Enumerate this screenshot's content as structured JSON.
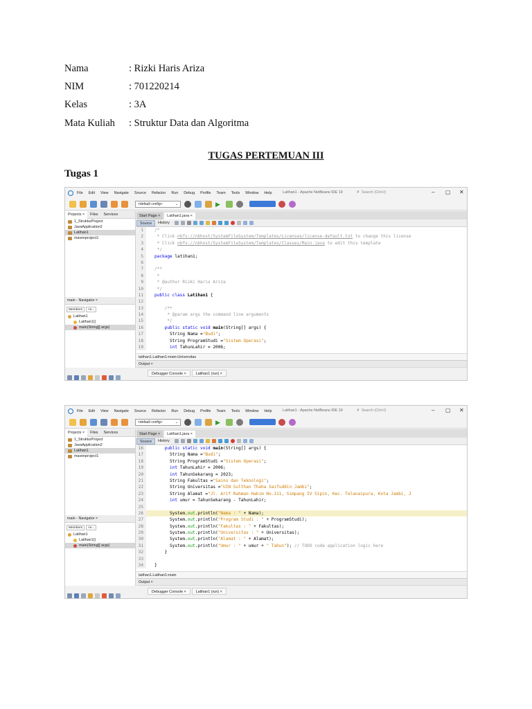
{
  "student": {
    "rows": [
      {
        "label": "Nama",
        "value": ": Rizki Haris Ariza"
      },
      {
        "label": "NIM",
        "value": ": 701220214"
      },
      {
        "label": "Kelas",
        "value": ": 3A"
      },
      {
        "label": "Mata Kuliah",
        "value": ": Struktur Data dan Algoritma"
      }
    ]
  },
  "heading": "TUGAS PERTEMUAN III",
  "task": "Tugas 1",
  "ide": {
    "menu": [
      "File",
      "Edit",
      "View",
      "Navigate",
      "Source",
      "Refactor",
      "Run",
      "Debug",
      "Profile",
      "Team",
      "Tools",
      "Window",
      "Help"
    ],
    "window_title": "Latihan1 - Apache NetBeans IDE 19",
    "search_placeholder": "Search (Ctrl+I)",
    "config": "<default config>",
    "panel_tabs": [
      "Projects ×",
      "Files",
      "Services"
    ],
    "projects": [
      "1_StrukturProject",
      "JavaApplication2",
      "Latihan1",
      "mavenproject1"
    ],
    "navigator_title": "main - Navigator ×",
    "members_label": "Members",
    "members_filter": "<e...",
    "navigator_items": [
      "Latihan1",
      "Latihan1()",
      "main(String[] args)"
    ],
    "doc_tabs": [
      "Start Page ×",
      "Latihan1.java ×"
    ],
    "source_tab": "Source",
    "history_tab": "History",
    "breadcrumb": [
      "latihan1.Latihan1",
      "main",
      "Universitas"
    ],
    "breadcrumb2": [
      "latihan1.Latihan1",
      "main"
    ],
    "output_title": "Output ×",
    "output_tabs": [
      "Debugger Console ×",
      "Latihan1 (run) ×"
    ]
  },
  "code1": [
    {
      "n": "1",
      "parts": [
        {
          "t": "/*",
          "c": "c-comment"
        }
      ]
    },
    {
      "n": "2",
      "parts": [
        {
          "t": " * Click ",
          "c": "c-comment"
        },
        {
          "t": "nbfs://nbhost/SystemFileSystem/Templates/Licenses/license-default.txt",
          "c": "c-link"
        },
        {
          "t": " to change this license",
          "c": "c-comment"
        }
      ]
    },
    {
      "n": "3",
      "parts": [
        {
          "t": " * Click ",
          "c": "c-comment"
        },
        {
          "t": "nbfs://nbhost/SystemFileSystem/Templates/Classes/Main.java",
          "c": "c-link"
        },
        {
          "t": " to edit this template",
          "c": "c-comment"
        }
      ]
    },
    {
      "n": "4",
      "parts": [
        {
          "t": " */",
          "c": "c-comment"
        }
      ]
    },
    {
      "n": "5",
      "parts": [
        {
          "t": "package",
          "c": "c-keyword"
        },
        {
          "t": " latihan1;",
          "c": ""
        }
      ]
    },
    {
      "n": "6",
      "parts": [
        {
          "t": "",
          "c": ""
        }
      ]
    },
    {
      "n": "7",
      "parts": [
        {
          "t": "/**",
          "c": "c-comment"
        }
      ]
    },
    {
      "n": "8",
      "parts": [
        {
          "t": " *",
          "c": "c-comment"
        }
      ]
    },
    {
      "n": "9",
      "parts": [
        {
          "t": " * @author Rizki Haris Ariza",
          "c": "c-comment"
        }
      ]
    },
    {
      "n": "10",
      "parts": [
        {
          "t": " */",
          "c": "c-comment"
        }
      ]
    },
    {
      "n": "11",
      "parts": [
        {
          "t": "public class",
          "c": "c-keyword"
        },
        {
          "t": " ",
          "c": ""
        },
        {
          "t": "Latihan1",
          "c": "c-bold"
        },
        {
          "t": " {",
          "c": ""
        }
      ]
    },
    {
      "n": "12",
      "parts": [
        {
          "t": "",
          "c": ""
        }
      ]
    },
    {
      "n": "13",
      "parts": [
        {
          "t": "    /**",
          "c": "c-comment"
        }
      ]
    },
    {
      "n": "14",
      "parts": [
        {
          "t": "     * @param args the command line arguments",
          "c": "c-comment"
        }
      ]
    },
    {
      "n": "15",
      "parts": [
        {
          "t": "     */",
          "c": "c-comment"
        }
      ]
    },
    {
      "n": "16",
      "parts": [
        {
          "t": "    public static void",
          "c": "c-keyword"
        },
        {
          "t": " ",
          "c": ""
        },
        {
          "t": "main",
          "c": "c-bold"
        },
        {
          "t": "(String[] args) {",
          "c": ""
        }
      ]
    },
    {
      "n": "17",
      "parts": [
        {
          "t": "      String Nama =",
          "c": ""
        },
        {
          "t": "\"Budi\"",
          "c": "c-string"
        },
        {
          "t": ";",
          "c": ""
        }
      ]
    },
    {
      "n": "18",
      "parts": [
        {
          "t": "      String ProgramStudi =",
          "c": ""
        },
        {
          "t": "\"Sistem Operasi\"",
          "c": "c-string"
        },
        {
          "t": ";",
          "c": ""
        }
      ]
    },
    {
      "n": "19",
      "parts": [
        {
          "t": "      int",
          "c": "c-keyword"
        },
        {
          "t": " TahunLahir = 2006;",
          "c": ""
        }
      ]
    }
  ],
  "code2": [
    {
      "n": "16",
      "parts": [
        {
          "t": "    public static void",
          "c": "c-keyword"
        },
        {
          "t": " ",
          "c": ""
        },
        {
          "t": "main",
          "c": "c-bold"
        },
        {
          "t": "(String[] args) {",
          "c": ""
        }
      ]
    },
    {
      "n": "17",
      "parts": [
        {
          "t": "      String Nama =",
          "c": ""
        },
        {
          "t": "\"Budi\"",
          "c": "c-string"
        },
        {
          "t": ";",
          "c": ""
        }
      ]
    },
    {
      "n": "18",
      "parts": [
        {
          "t": "      String ProgramStudi =",
          "c": ""
        },
        {
          "t": "\"Sistem Operasi\"",
          "c": "c-string"
        },
        {
          "t": ";",
          "c": ""
        }
      ]
    },
    {
      "n": "19",
      "parts": [
        {
          "t": "      int",
          "c": "c-keyword"
        },
        {
          "t": " TahunLahir = 2006;",
          "c": ""
        }
      ]
    },
    {
      "n": "20",
      "parts": [
        {
          "t": "      int",
          "c": "c-keyword"
        },
        {
          "t": " TahunSekarang = 2023;",
          "c": ""
        }
      ]
    },
    {
      "n": "21",
      "parts": [
        {
          "t": "      String Fakultas =",
          "c": ""
        },
        {
          "t": "\"Sains dan Teknologi\"",
          "c": "c-string"
        },
        {
          "t": ";",
          "c": ""
        }
      ]
    },
    {
      "n": "22",
      "parts": [
        {
          "t": "      String Universitas =",
          "c": ""
        },
        {
          "t": "\"UIN Sulthan Thaha Saifuddin Jambi\"",
          "c": "c-string"
        },
        {
          "t": ";",
          "c": ""
        }
      ]
    },
    {
      "n": "23",
      "parts": [
        {
          "t": "      String Alamat =",
          "c": ""
        },
        {
          "t": "\"Jl. Arif Rahman Hakim No.111, Simpang IV Sipin, Kec. Telanaipura, Kota Jambi, J",
          "c": "c-string"
        }
      ]
    },
    {
      "n": "24",
      "parts": [
        {
          "t": "      int",
          "c": "c-keyword"
        },
        {
          "t": " umur = TahunSekarang - TahunLahir;",
          "c": ""
        }
      ]
    },
    {
      "n": "25",
      "parts": [
        {
          "t": "",
          "c": ""
        }
      ]
    },
    {
      "n": "26",
      "hl": true,
      "parts": [
        {
          "t": "      System.",
          "c": ""
        },
        {
          "t": "out",
          "c": "c-field"
        },
        {
          "t": ".println(",
          "c": ""
        },
        {
          "t": "\"Nama : \"",
          "c": "c-string"
        },
        {
          "t": " + Nama);",
          "c": ""
        }
      ]
    },
    {
      "n": "27",
      "parts": [
        {
          "t": "      System.",
          "c": ""
        },
        {
          "t": "out",
          "c": "c-field"
        },
        {
          "t": ".println(",
          "c": ""
        },
        {
          "t": "\"Program Studi : \"",
          "c": "c-string"
        },
        {
          "t": " + ProgramStudi);",
          "c": ""
        }
      ]
    },
    {
      "n": "28",
      "parts": [
        {
          "t": "      System.",
          "c": ""
        },
        {
          "t": "out",
          "c": "c-field"
        },
        {
          "t": ".println(",
          "c": ""
        },
        {
          "t": "\"Fakultas : \"",
          "c": "c-string"
        },
        {
          "t": " + Fakultas);",
          "c": ""
        }
      ]
    },
    {
      "n": "29",
      "parts": [
        {
          "t": "      System.",
          "c": ""
        },
        {
          "t": "out",
          "c": "c-field"
        },
        {
          "t": ".println(",
          "c": ""
        },
        {
          "t": "\"Universitas : \"",
          "c": "c-string"
        },
        {
          "t": " + Universitas);",
          "c": ""
        }
      ]
    },
    {
      "n": "30",
      "parts": [
        {
          "t": "      System.",
          "c": ""
        },
        {
          "t": "out",
          "c": "c-field"
        },
        {
          "t": ".println(",
          "c": ""
        },
        {
          "t": "\"Alamat : \"",
          "c": "c-string"
        },
        {
          "t": " + Alamat);",
          "c": ""
        }
      ]
    },
    {
      "n": "31",
      "parts": [
        {
          "t": "      System.",
          "c": ""
        },
        {
          "t": "out",
          "c": "c-field"
        },
        {
          "t": ".println(",
          "c": ""
        },
        {
          "t": "\"Umur : \"",
          "c": "c-string"
        },
        {
          "t": " + umur + ",
          "c": ""
        },
        {
          "t": "\" Tahun\"",
          "c": "c-string"
        },
        {
          "t": "); ",
          "c": ""
        },
        {
          "t": "// TODO code application logic here",
          "c": "c-comment"
        }
      ]
    },
    {
      "n": "32",
      "parts": [
        {
          "t": "    }",
          "c": ""
        }
      ]
    },
    {
      "n": "33",
      "parts": [
        {
          "t": "",
          "c": ""
        }
      ]
    },
    {
      "n": "34",
      "parts": [
        {
          "t": "}",
          "c": ""
        }
      ]
    }
  ]
}
